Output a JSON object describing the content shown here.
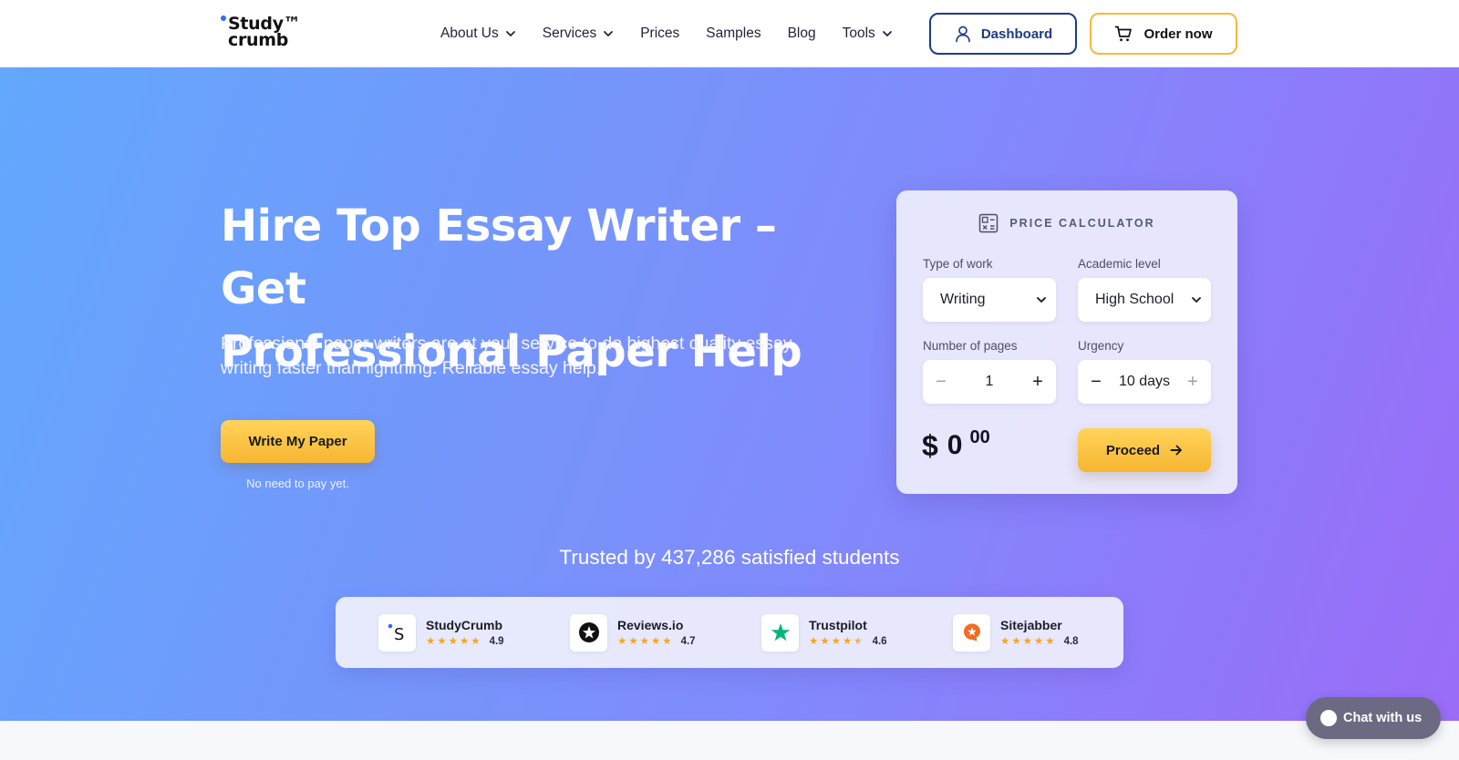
{
  "header": {
    "logo_line1": "Study™",
    "logo_line2": "crumb",
    "nav": [
      {
        "label": "About Us",
        "has_dropdown": true
      },
      {
        "label": "Services",
        "has_dropdown": true
      },
      {
        "label": "Prices",
        "has_dropdown": false
      },
      {
        "label": "Samples",
        "has_dropdown": false
      },
      {
        "label": "Blog",
        "has_dropdown": false
      },
      {
        "label": "Tools",
        "has_dropdown": true
      }
    ],
    "dashboard_label": "Dashboard",
    "order_label": "Order now"
  },
  "hero": {
    "title_line1": "Hire Top Essay Writer – Get",
    "title_line2": "Professional Paper Help",
    "subtitle": "Professional paper writers are at your service to do highest quality essay writing faster than lightning. Reliable essay help.",
    "cta_label": "Write My Paper",
    "cta_note": "No need to pay yet."
  },
  "calculator": {
    "title": "PRICE CALCULATOR",
    "type_label": "Type of work",
    "type_value": "Writing",
    "level_label": "Academic level",
    "level_value": "High School",
    "pages_label": "Number of pages",
    "pages_value": "1",
    "urgency_label": "Urgency",
    "urgency_value": "10 days",
    "price_currency": "$",
    "price_main": "0",
    "price_cents": "00",
    "proceed_label": "Proceed"
  },
  "trust": {
    "headline": "Trusted by 437,286 satisfied students",
    "reviews": [
      {
        "name": "StudyCrumb",
        "rating": "4.9",
        "stars": 5
      },
      {
        "name": "Reviews.io",
        "rating": "4.7",
        "stars": 5
      },
      {
        "name": "Trustpilot",
        "rating": "4.6",
        "stars": 4.5
      },
      {
        "name": "Sitejabber",
        "rating": "4.8",
        "stars": 5
      }
    ]
  },
  "chat": {
    "label": "Chat with us"
  },
  "colors": {
    "accent_blue": "#1f3a8a",
    "accent_yellow": "#f7b632",
    "hero_gradient_start": "#62a8fd",
    "hero_gradient_end": "#9a6cf8",
    "trustpilot_green": "#00b67a",
    "sitejabber_orange": "#f26b22"
  },
  "icons": [
    "chevron-down-icon",
    "user-icon",
    "cart-icon",
    "calculator-icon",
    "arrow-right-icon",
    "star-icon",
    "chat-bubble-icon"
  ]
}
